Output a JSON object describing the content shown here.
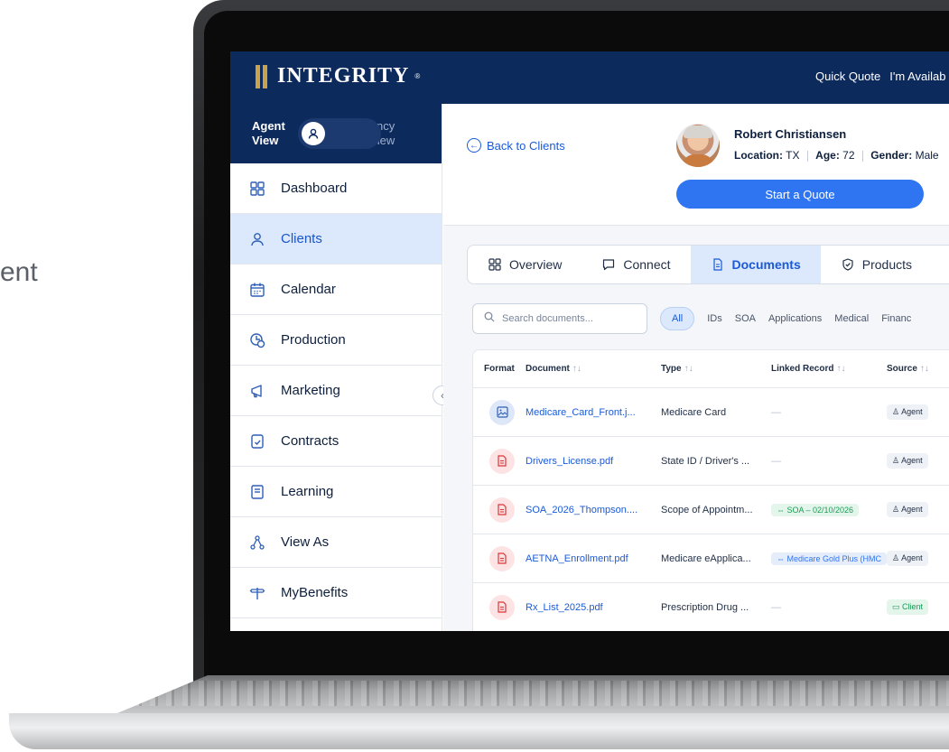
{
  "background_text": "ent",
  "app": {
    "brand": "INTEGRITY",
    "brand_reg": "®",
    "top_links": [
      "Quick Quote",
      "I'm Availab"
    ]
  },
  "sidebar": {
    "toggle": {
      "left_line1": "Agent",
      "left_line2": "View",
      "right_line1": "Agency",
      "right_line2": "View"
    },
    "items": [
      {
        "label": "Dashboard",
        "icon": "grid-icon"
      },
      {
        "label": "Clients",
        "icon": "person-icon",
        "active": true
      },
      {
        "label": "Calendar",
        "icon": "calendar-icon"
      },
      {
        "label": "Production",
        "icon": "production-icon"
      },
      {
        "label": "Marketing",
        "icon": "megaphone-icon"
      },
      {
        "label": "Contracts",
        "icon": "contract-icon"
      },
      {
        "label": "Learning",
        "icon": "book-icon"
      },
      {
        "label": "View As",
        "icon": "network-icon"
      },
      {
        "label": "MyBenefits",
        "icon": "signpost-icon"
      }
    ]
  },
  "client": {
    "back_label": "Back to Clients",
    "name": "Robert Christiansen",
    "location_label": "Location:",
    "location": "TX",
    "age_label": "Age:",
    "age": "72",
    "gender_label": "Gender:",
    "gender": "Male",
    "start_quote": "Start a Quote"
  },
  "tabs": [
    {
      "label": "Overview",
      "icon": "grid-icon"
    },
    {
      "label": "Connect",
      "icon": "chat-icon"
    },
    {
      "label": "Documents",
      "icon": "document-icon",
      "active": true
    },
    {
      "label": "Products",
      "icon": "shield-icon"
    }
  ],
  "documents": {
    "search_placeholder": "Search documents...",
    "filters": [
      "All",
      "IDs",
      "SOA",
      "Applications",
      "Medical",
      "Financ"
    ],
    "columns": {
      "format": "Format",
      "document": "Document",
      "type": "Type",
      "linked": "Linked Record",
      "source": "Source"
    },
    "sort_glyph": "↑↓",
    "rows": [
      {
        "format": "image",
        "document": "Medicare_Card_Front.j...",
        "type": "Medicare Card",
        "linked": "—",
        "linked_kind": "none",
        "source": "Agent"
      },
      {
        "format": "pdf",
        "document": "Drivers_License.pdf",
        "type": "State ID / Driver's ...",
        "linked": "—",
        "linked_kind": "none",
        "source": "Agent"
      },
      {
        "format": "pdf",
        "document": "SOA_2026_Thompson....",
        "type": "Scope of Appointm...",
        "linked": "⇔ SOA – 02/10/2026",
        "linked_kind": "soa",
        "source": "Agent"
      },
      {
        "format": "pdf",
        "document": "AETNA_Enrollment.pdf",
        "type": "Medicare eApplica...",
        "linked": "⇔ Medicare Gold Plus (HMC",
        "linked_kind": "plan",
        "source": "Agent"
      },
      {
        "format": "pdf",
        "document": "Rx_List_2025.pdf",
        "type": "Prescription Drug ...",
        "linked": "—",
        "linked_kind": "none",
        "source": "Client"
      }
    ]
  },
  "colors": {
    "brand_navy": "#0d2a5c",
    "accent_blue": "#2f74f0",
    "gold": "#c9a24b"
  }
}
